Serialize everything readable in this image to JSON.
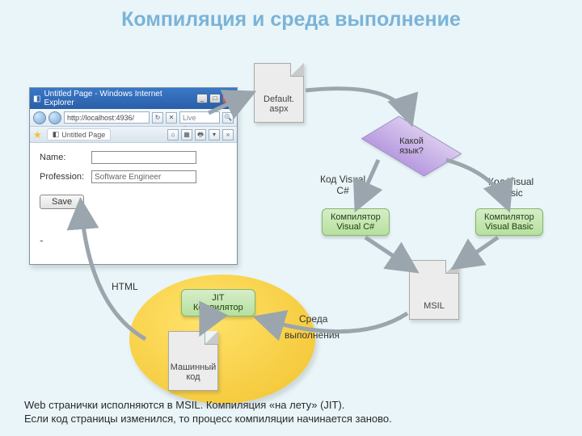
{
  "title": "Компиляция и среда выполнение",
  "browser": {
    "window_title": "Untitled Page - Windows Internet Explorer",
    "address": "http://localhost:4936/",
    "search_placeholder": "Live Search",
    "tab_title": "Untitled Page",
    "form": {
      "name_label": "Name:",
      "name_value": "",
      "profession_label": "Profession:",
      "profession_value": "Software Engineer",
      "save_label": "Save"
    }
  },
  "nodes": {
    "default_aspx": "Default.\naspx",
    "decision": "Какой\nязык?",
    "branch_left": "Код Visual\nC#",
    "branch_right": "Код Visual\nBasic",
    "compiler_csharp": "Компилятор\nVisual C#",
    "compiler_vb": "Компилятор\nVisual Basic",
    "msil": "MSIL",
    "jit": "JIT\nКомпилятор",
    "machine": "Машинный\nкод",
    "runtime_label_1": "Среда",
    "runtime_label_2": "выполнения",
    "html_label": "HTML"
  },
  "footer_line1": "Web странички исполняются в MSIL. Компиляция «на лету» (JIT).",
  "footer_line2": "Если код страницы изменился, то процесс компиляции начинается заново."
}
